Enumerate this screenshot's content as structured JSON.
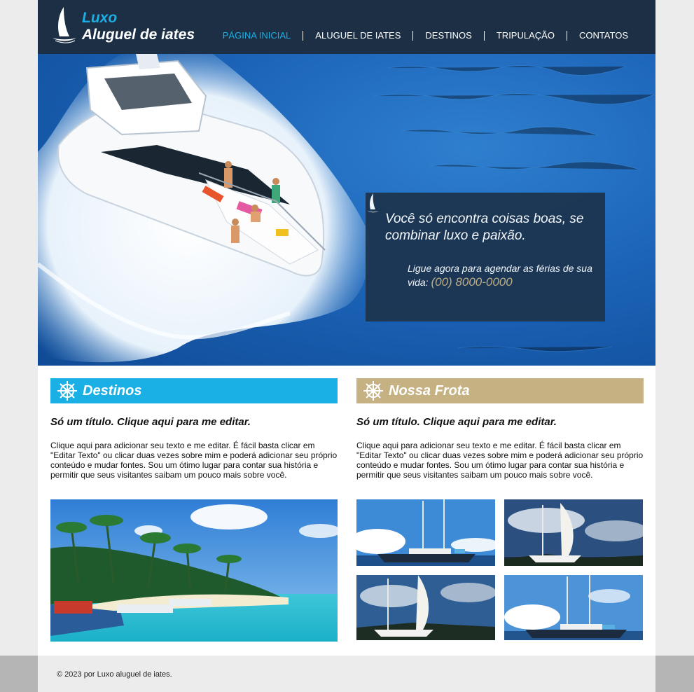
{
  "header": {
    "logo_line1": "Luxo",
    "logo_line2": "Aluguel de iates",
    "nav": [
      {
        "label": "PÁGINA INICIAL",
        "active": true
      },
      {
        "label": "ALUGUEL DE IATES",
        "active": false
      },
      {
        "label": "DESTINOS",
        "active": false
      },
      {
        "label": "TRIPULAÇÃO",
        "active": false
      },
      {
        "label": "CONTATOS",
        "active": false
      }
    ]
  },
  "hero": {
    "title": "Você só encontra coisas boas, se combinar luxo e paixão.",
    "text": "Ligue agora para agendar as férias de sua vida:",
    "phone": "(00) 8000-0000"
  },
  "destinos": {
    "bar_title": "Destinos",
    "heading": "Só um título. Clique aqui para me editar.",
    "body": "Clique aqui para adicionar seu texto e me editar. É fácil basta clicar em \"Editar Texto\" ou clicar duas vezes sobre mim e poderá adicionar seu próprio conteúdo e mudar fontes. Sou um ótimo lugar para contar sua história e permitir que seus visitantes saibam um pouco mais sobre você."
  },
  "frota": {
    "bar_title": "Nossa Frota",
    "heading": "Só um título. Clique aqui para me editar.",
    "body": "Clique aqui para adicionar seu texto e me editar. É fácil basta clicar em \"Editar Texto\" ou clicar duas vezes sobre mim e poderá adicionar seu próprio conteúdo e mudar fontes. Sou um ótimo lugar para contar sua história e permitir que seus visitantes saibam um pouco mais sobre você."
  },
  "footer": {
    "text": "© 2023 por Luxo aluguel de iates."
  },
  "colors": {
    "header_bg": "#1c2f45",
    "accent_blue": "#1ab0e6",
    "accent_tan": "#c5b182"
  },
  "icons": {
    "logo": "sailboat-icon",
    "section": "ship-wheel-icon"
  }
}
